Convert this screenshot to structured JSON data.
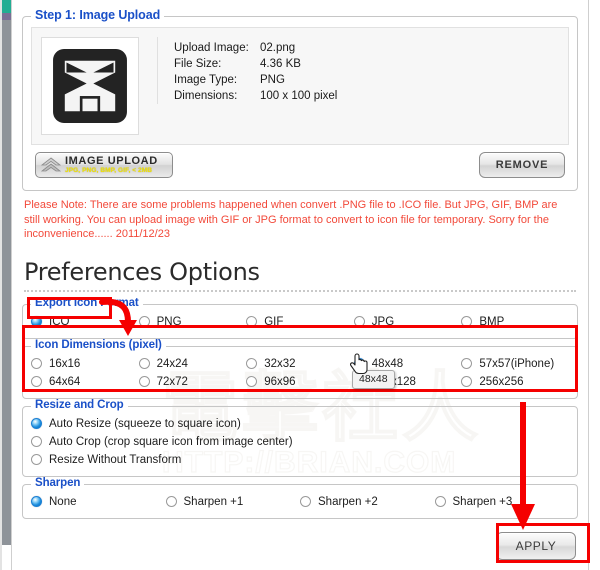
{
  "step1": {
    "legend": "Step 1: Image Upload",
    "thumbnail_icon": "uploaded-image-logo",
    "meta": [
      {
        "label": "Upload Image:",
        "value": "02.png"
      },
      {
        "label": "File Size:",
        "value": "4.36 KB"
      },
      {
        "label": "Image Type:",
        "value": "PNG"
      },
      {
        "label": "Dimensions:",
        "value": "100 x 100 pixel"
      }
    ],
    "upload_button": {
      "title": "IMAGE UPLOAD",
      "subtitle": "JPG, PNG, BMP, GIF, < 2MB",
      "icon": "double-chevron-up-icon"
    },
    "remove_button": "REMOVE",
    "note": "Please Note: There are some problems happened when convert .PNG file to .ICO file. But JPG, GIF, BMP are still working. You can upload image with GIF or JPG format to convert to icon file for temporary. Sorry for the inconvenience...... 2011/12/23"
  },
  "preferences": {
    "title": "Preferences Options",
    "export_format": {
      "legend": "Export Icon Format",
      "selected": "ICO",
      "options": [
        "ICO",
        "PNG",
        "GIF",
        "JPG",
        "BMP"
      ]
    },
    "icon_dimensions": {
      "legend": "Icon Dimensions (pixel)",
      "selected": "48x48",
      "row1": [
        "16x16",
        "24x24",
        "32x32",
        "48x48",
        "57x57(iPhone)"
      ],
      "row2": [
        "64x64",
        "72x72",
        "96x96",
        "128x128",
        "256x256"
      ]
    },
    "resize_and_crop": {
      "legend": "Resize and Crop",
      "selected": "Auto Resize (squeeze to square icon)",
      "options": [
        "Auto Resize (squeeze to square icon)",
        "Auto Crop (crop square icon from image center)",
        "Resize Without Transform"
      ]
    },
    "sharpen": {
      "legend": "Sharpen",
      "selected": "None",
      "options": [
        "None",
        "Sharpen +1",
        "Sharpen +2",
        "Sharpen +3"
      ]
    },
    "apply_button": "APPLY"
  },
  "overlay": {
    "tooltip": "48x48",
    "cursor": "pointing-hand-cursor",
    "annotation_color": "#f50000",
    "highlighted": [
      "ICO",
      "Icon Dimensions (pixel)",
      "APPLY"
    ]
  },
  "watermark": {
    "cjk": "電擊社人",
    "url": "HTTP://BRIAN.COM"
  },
  "colors": {
    "legend_blue": "#1a50c8",
    "note_red": "#f2493a",
    "radio_on_blue": "#1b8ede",
    "annotation_red": "#f50000"
  }
}
